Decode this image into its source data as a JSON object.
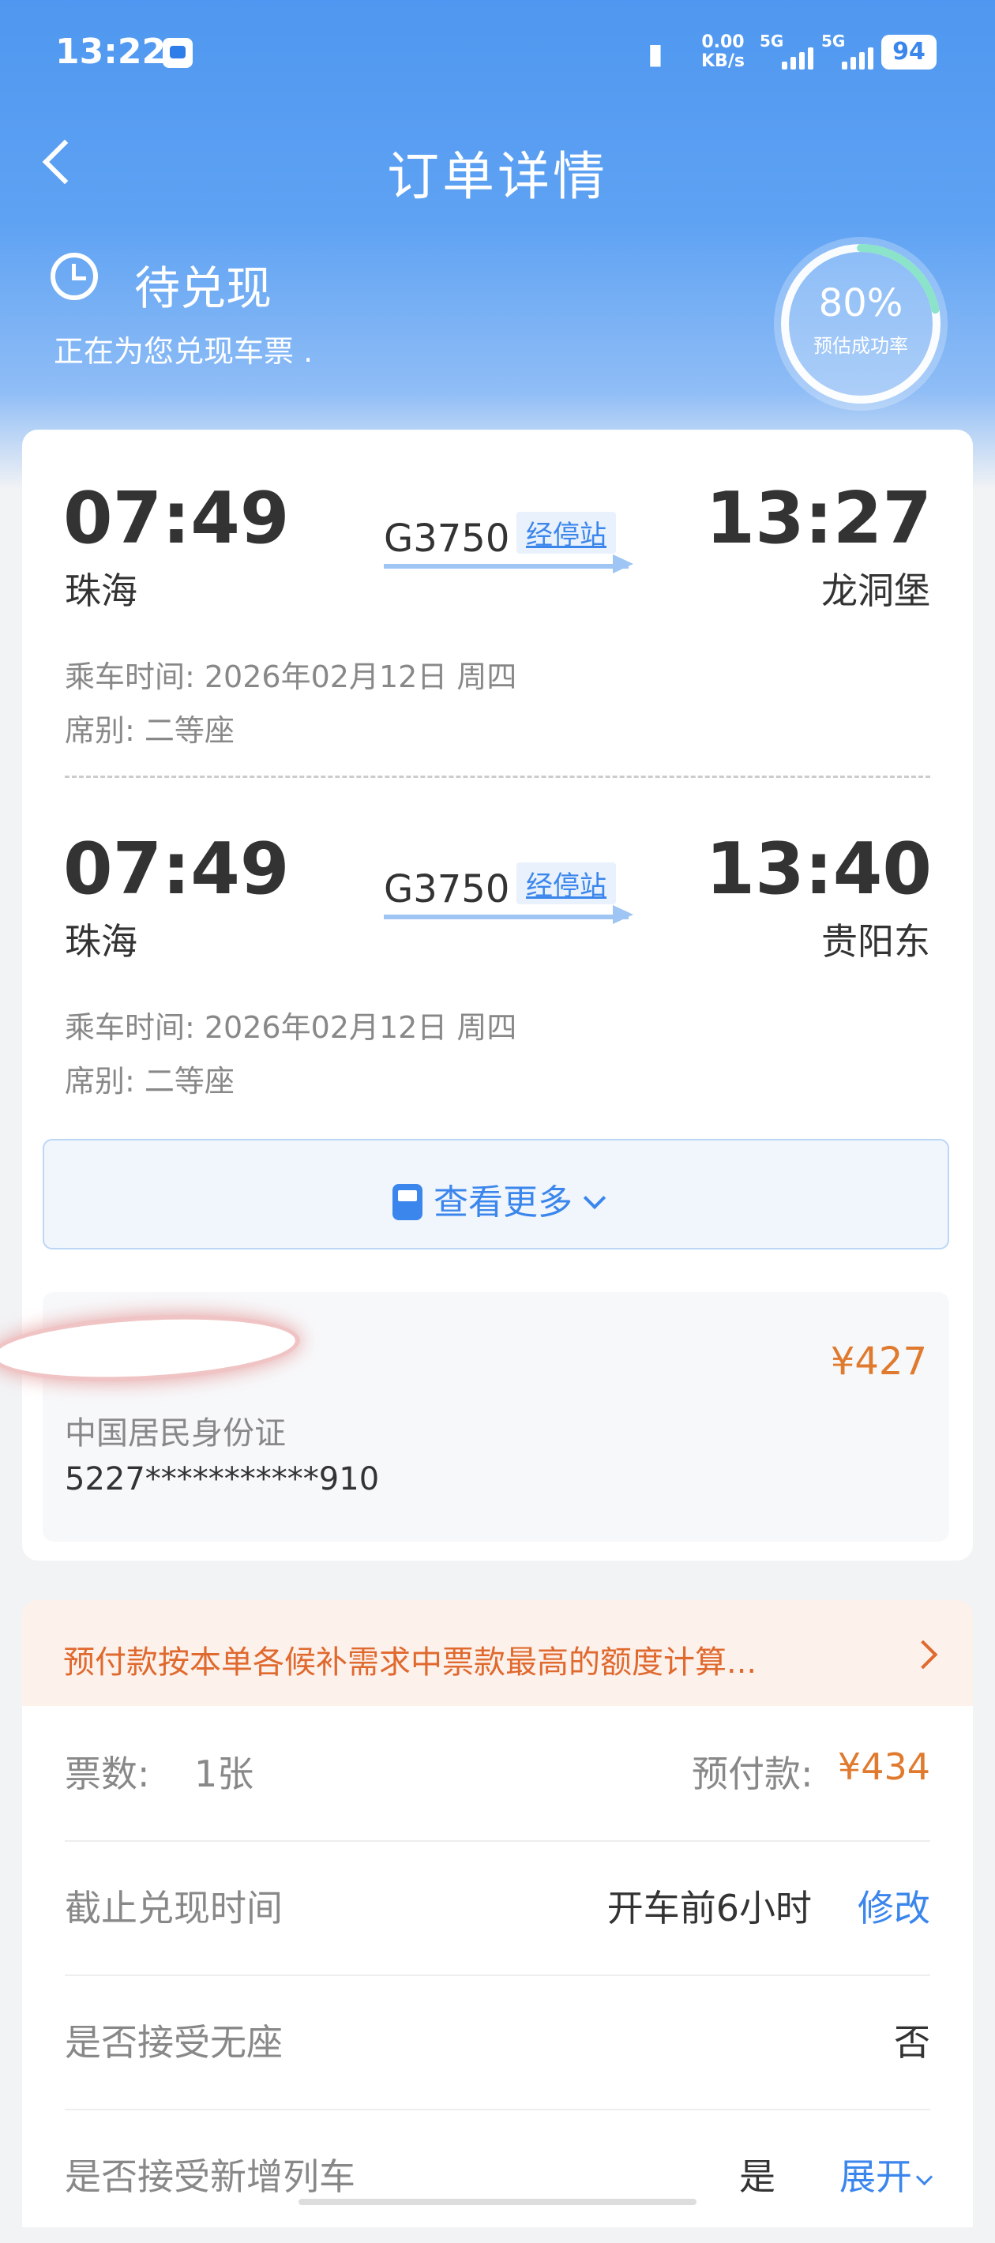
{
  "status_bar": {
    "time": "13:22",
    "net_speed_value": "0.00",
    "net_speed_unit": "KB/s",
    "sig1_label": "5G",
    "sig2_label": "5G",
    "battery": "94"
  },
  "header": {
    "title": "订单详情"
  },
  "order_status": {
    "label": "待兑现",
    "subtitle": "正在为您兑现车票 .",
    "success_rate": "80%",
    "success_rate_label": "预估成功率",
    "success_rate_value": 0.8
  },
  "trips": [
    {
      "depart_time": "07:49",
      "depart_station": "珠海",
      "train_no": "G3750",
      "stops_link": "经停站",
      "arrive_time": "13:27",
      "arrive_station": "龙洞堡",
      "ride_date": "乘车时间: 2026年02月12日 周四",
      "seat": "席别: 二等座"
    },
    {
      "depart_time": "07:49",
      "depart_station": "珠海",
      "train_no": "G3750",
      "stops_link": "经停站",
      "arrive_time": "13:40",
      "arrive_station": "贵阳东",
      "ride_date": "乘车时间: 2026年02月12日 周四",
      "seat": "席别: 二等座"
    }
  ],
  "view_more": "查看更多",
  "passenger": {
    "price": "¥427",
    "id_type": "中国居民身份证",
    "id_number": "5227***********910"
  },
  "notice": {
    "text": "预付款按本单各候补需求中票款最高的额度计算..."
  },
  "details": {
    "ticket_count_label": "票数:",
    "ticket_count": "1张",
    "prepay_label": "预付款:",
    "prepay_value": "¥434",
    "deadline_label": "截止兑现时间",
    "deadline_value": "开车前6小时",
    "deadline_action": "修改",
    "no_seat_label": "是否接受无座",
    "no_seat_value": "否",
    "new_train_label": "是否接受新增列车",
    "new_train_value": "是",
    "new_train_action": "展开"
  },
  "colors": {
    "primary": "#3b86ec",
    "accent_orange": "#e07a2e",
    "header_blue": "#4f97f0"
  }
}
